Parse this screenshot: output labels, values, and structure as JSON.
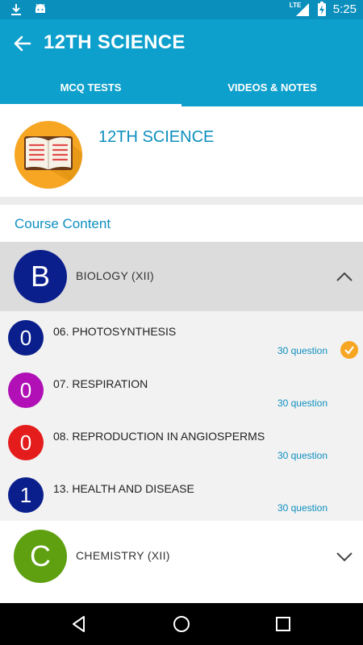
{
  "status_bar": {
    "time": "5:25",
    "network": "LTE",
    "icons": [
      "download-icon",
      "android-icon",
      "signal-icon",
      "battery-icon"
    ]
  },
  "app_bar": {
    "title": "12TH SCIENCE"
  },
  "tabs": [
    {
      "label": "MCQ TESTS",
      "active": true
    },
    {
      "label": "VIDEOS & NOTES",
      "active": false
    }
  ],
  "course": {
    "title": "12TH SCIENCE",
    "icon": "book-icon"
  },
  "content": {
    "label": "Course Content",
    "subjects": [
      {
        "letter": "B",
        "name": "BIOLOGY (XII)",
        "color": "#0b1f8c",
        "expanded": true,
        "topics": [
          {
            "count": "0",
            "name": "06. PHOTOSYNTHESIS",
            "questions": "30 question",
            "color": "#0b1f8c",
            "completed": true
          },
          {
            "count": "0",
            "name": "07. RESPIRATION",
            "questions": "30 question",
            "color": "#b010b5",
            "completed": false
          },
          {
            "count": "0",
            "name": "08. REPRODUCTION IN ANGIOSPERMS",
            "questions": "30 question",
            "color": "#e51c1c",
            "completed": false
          },
          {
            "count": "1",
            "name": "13. HEALTH AND DISEASE",
            "questions": "30 question",
            "color": "#0b1f8c",
            "completed": false
          }
        ]
      },
      {
        "letter": "C",
        "name": "CHEMISTRY (XII)",
        "color": "#5ea010",
        "expanded": false
      }
    ]
  },
  "colors": {
    "primary": "#0ea0cc",
    "accent": "#f6a623",
    "link": "#0e8fbf"
  }
}
